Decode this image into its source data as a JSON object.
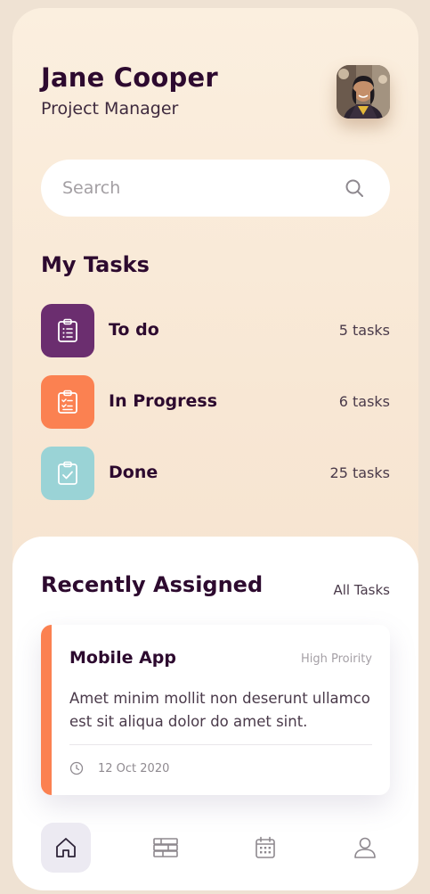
{
  "profile": {
    "name": "Jane Cooper",
    "role": "Project Manager"
  },
  "search": {
    "placeholder": "Search",
    "value": ""
  },
  "my_tasks": {
    "title": "My Tasks",
    "items": [
      {
        "label": "To do",
        "count": "5 tasks",
        "color": "#6b2e6f",
        "icon": "clipboard-list-icon"
      },
      {
        "label": "In Progress",
        "count": "6 tasks",
        "color": "#fb8151",
        "icon": "clipboard-progress-icon"
      },
      {
        "label": "Done",
        "count": "25 tasks",
        "color": "#9ad3d6",
        "icon": "clipboard-check-icon"
      }
    ]
  },
  "recently_assigned": {
    "title": "Recently Assigned",
    "all_tasks_label": "All Tasks",
    "card": {
      "title": "Mobile App",
      "priority": "High Proirity",
      "description": "Amet minim mollit non deserunt ullamco est sit aliqua dolor do amet sint.",
      "date": "12 Oct 2020",
      "accent_color": "#fb8151"
    }
  },
  "nav": {
    "items": [
      {
        "icon": "home-icon",
        "active": true
      },
      {
        "icon": "board-icon",
        "active": false
      },
      {
        "icon": "calendar-icon",
        "active": false
      },
      {
        "icon": "profile-icon",
        "active": false
      }
    ]
  },
  "colors": {
    "primary_text": "#2d0a2f",
    "background": "#f8e7d4",
    "todo": "#6b2e6f",
    "in_progress": "#fb8151",
    "done": "#9ad3d6"
  }
}
